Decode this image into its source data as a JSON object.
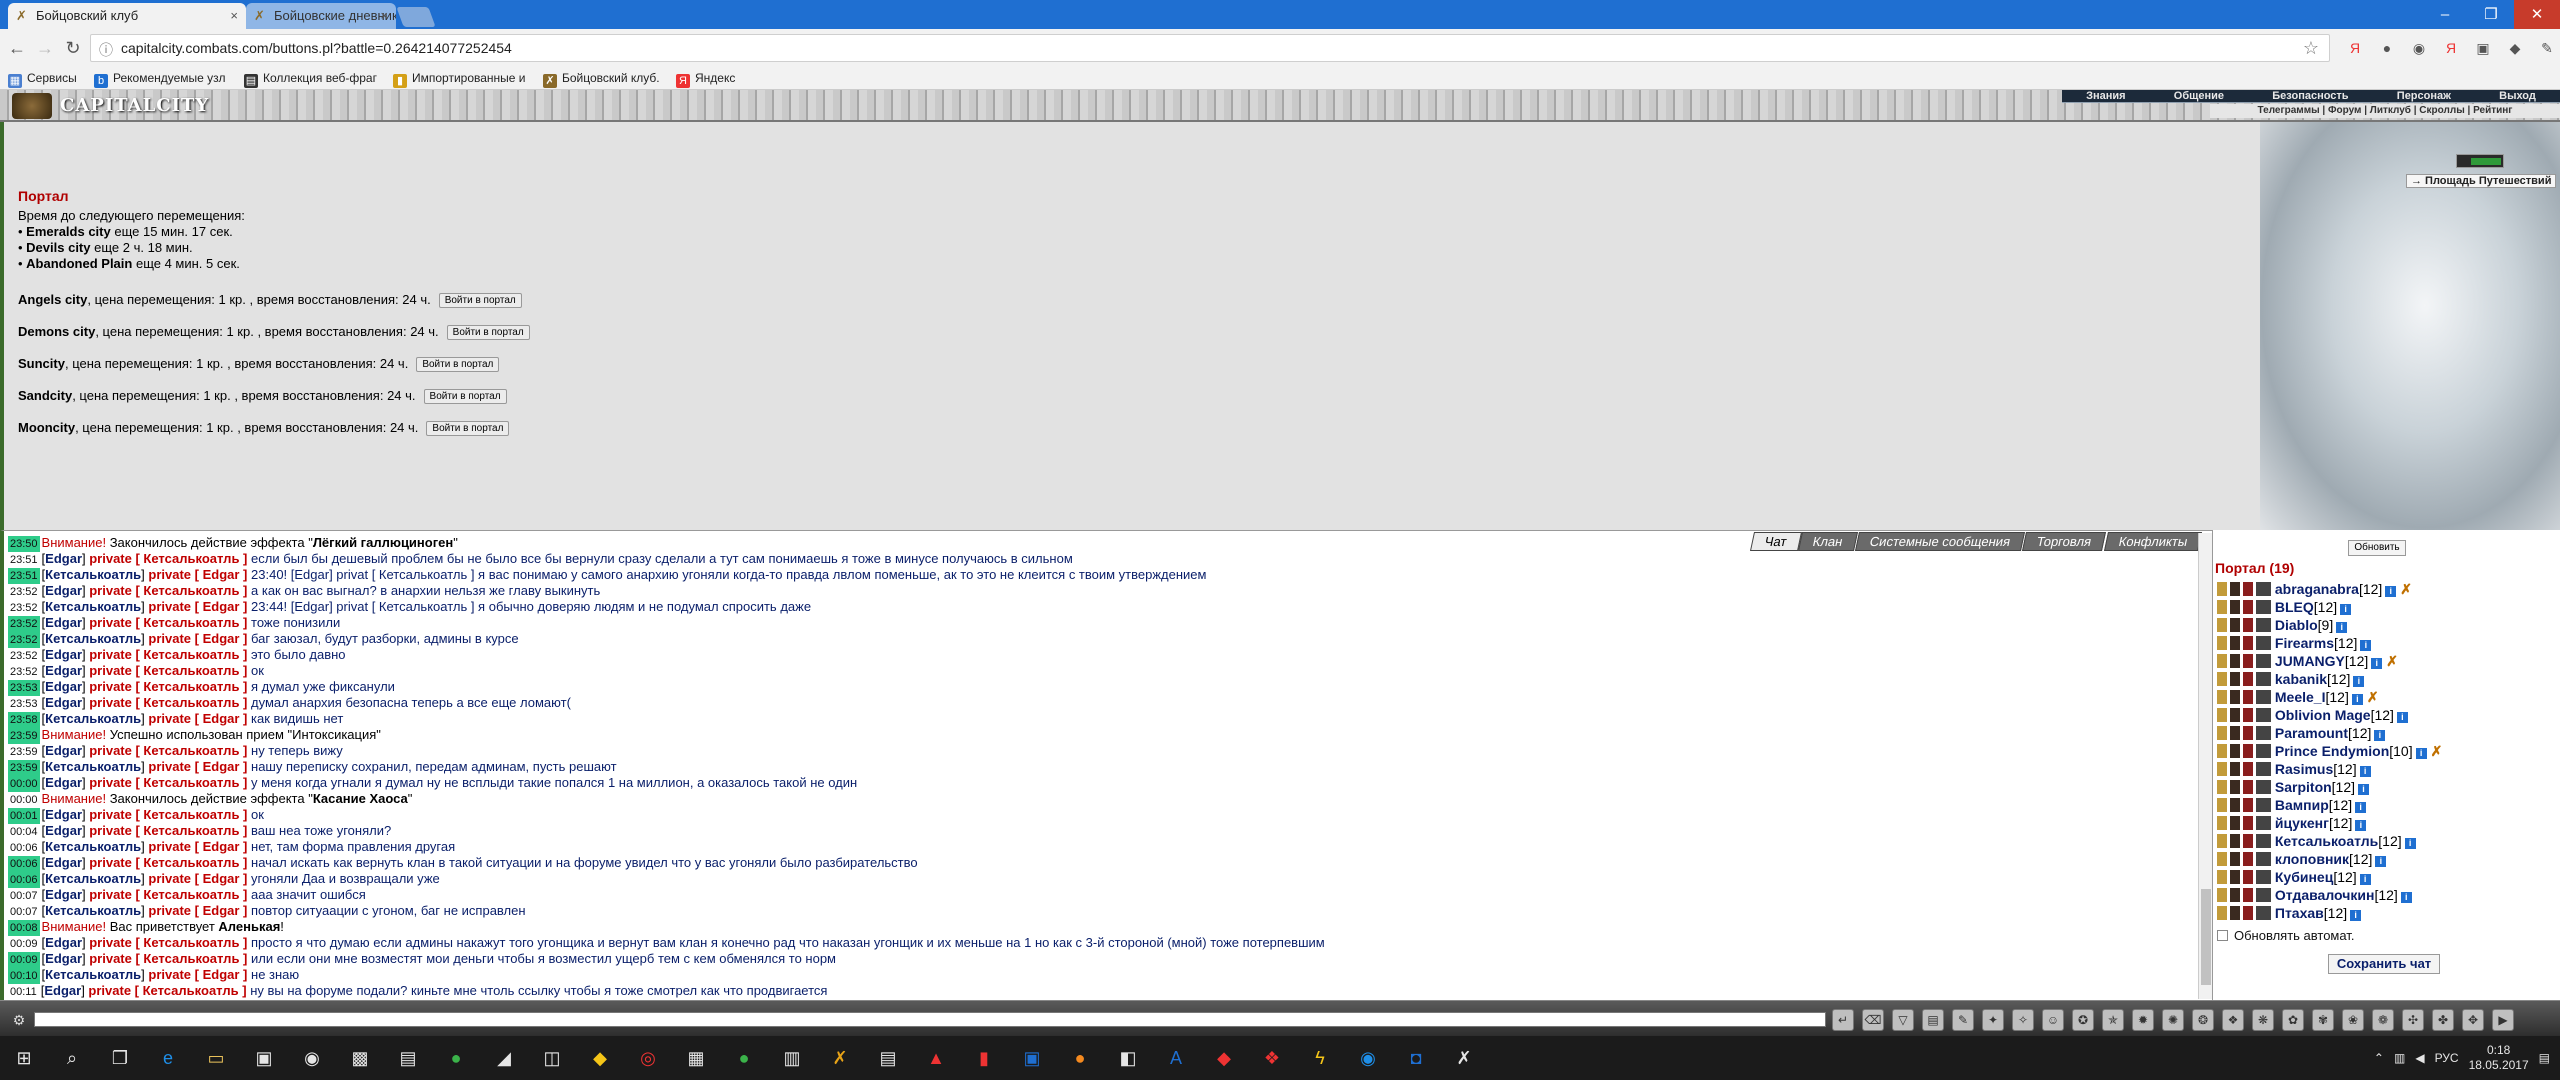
{
  "browser": {
    "tabs": [
      {
        "label": "Бойцовский клуб",
        "close": "×"
      },
      {
        "label": "Бойцовские дневники -",
        "close": "×"
      }
    ],
    "url": "capitalcity.combats.com/buttons.pl?battle=0.264214077252454",
    "bookmarks": [
      "Сервисы",
      "Рекомендуемые узл",
      "Коллекция веб-фраг",
      "Импортированные и",
      "Бойцовский клуб.",
      "Яндекс"
    ]
  },
  "game": {
    "logo": "CAPITALCITY",
    "menu": [
      "Знания",
      "Общение",
      "Безопасность",
      "Персонаж",
      "Выход"
    ],
    "submenu": "Телеграммы | Форум | Литклуб | Скроллы | Рейтинг",
    "location_button": "→ Площадь Путешествий"
  },
  "portal": {
    "title": "Портал",
    "next_move_label": "Время до следующего перемещения:",
    "timers": [
      {
        "city": "Emeralds city",
        "rest": "еще 15 мин. 17 сек."
      },
      {
        "city": "Devils city",
        "rest": "еще 2 ч. 18 мин."
      },
      {
        "city": "Abandoned Plain",
        "rest": "еще 4 мин. 5 сек."
      }
    ],
    "cities": [
      {
        "name": "Angels city",
        "info": ", цена перемещения: 1 кр. , время восстановления: 24 ч."
      },
      {
        "name": "Demons city",
        "info": ", цена перемещения: 1 кр. , время восстановления: 24 ч."
      },
      {
        "name": "Suncity",
        "info": ", цена перемещения: 1 кр. , время восстановления: 24 ч."
      },
      {
        "name": "Sandcity",
        "info": ", цена перемещения: 1 кр. , время восстановления: 24 ч."
      },
      {
        "name": "Mooncity",
        "info": ", цена перемещения: 1 кр. , время восстановления: 24 ч."
      }
    ],
    "enter_button": "Войти в портал"
  },
  "chat": {
    "tabs": [
      "Чат",
      "Клан",
      "Системные сообщения",
      "Торговля",
      "Конфликты"
    ],
    "messages": [
      {
        "t": "23:50",
        "kind": "sys",
        "pre": "Внимание!",
        "text": " Закончилось действие эффекта \"",
        "bold": "Лёгкий галлюциноген",
        "post": "\""
      },
      {
        "t": "23:51",
        "kind": "pm",
        "from": "Edgar",
        "to": "Кетсалькоатль",
        "text": "если был бы дешевый проблем бы не было все бы вернули сразу сделали а тут сам понимаешь я тоже в минусе получаюсь в сильном"
      },
      {
        "t": "23:51",
        "kind": "pm",
        "from": "Кетсалькоатль",
        "to": "Edgar",
        "text": "23:40! [Edgar] privat [ Кетсалькоатль ] я вас понимаю у самого анархию угоняли когда-то правда лвлом поменьше, ак то это не клеится с твоим утверждением"
      },
      {
        "t": "23:52",
        "kind": "pm",
        "from": "Edgar",
        "to": "Кетсалькоатль",
        "text": "а как он вас выгнал? в анархии нельзя же главу выкинуть"
      },
      {
        "t": "23:52",
        "kind": "pm",
        "from": "Кетсалькоатль",
        "to": "Edgar",
        "text": "23:44! [Edgar] privat [ Кетсалькоатль ] я обычно доверяю людям и не подумал спросить даже"
      },
      {
        "t": "23:52",
        "kind": "pm",
        "from": "Edgar",
        "to": "Кетсалькоатль",
        "text": "тоже понизили"
      },
      {
        "t": "23:52",
        "kind": "pm",
        "from": "Кетсалькоатль",
        "to": "Edgar",
        "text": "баг заюзал, будут разборки, админы в курсе"
      },
      {
        "t": "23:52",
        "kind": "pm",
        "from": "Edgar",
        "to": "Кетсалькоатль",
        "text": "это было давно"
      },
      {
        "t": "23:52",
        "kind": "pm",
        "from": "Edgar",
        "to": "Кетсалькоатль",
        "text": "ок"
      },
      {
        "t": "23:53",
        "kind": "pm",
        "from": "Edgar",
        "to": "Кетсалькоатль",
        "text": "я думал уже фиксанули"
      },
      {
        "t": "23:53",
        "kind": "pm",
        "from": "Edgar",
        "to": "Кетсалькоатль",
        "text": "думал анархия безопасна теперь а все еще ломают("
      },
      {
        "t": "23:58",
        "kind": "pm",
        "from": "Кетсалькоатль",
        "to": "Edgar",
        "text": "как видишь нет"
      },
      {
        "t": "23:59",
        "kind": "sys",
        "pre": "Внимание!",
        "text": " Успешно использован прием \"Интоксикация\"",
        "bold": "",
        "post": ""
      },
      {
        "t": "23:59",
        "kind": "pm",
        "from": "Edgar",
        "to": "Кетсалькоатль",
        "text": "ну теперь вижу"
      },
      {
        "t": "23:59",
        "kind": "pm",
        "from": "Кетсалькоатль",
        "to": "Edgar",
        "text": "нашу переписку сохранил, передам админам, пусть решают"
      },
      {
        "t": "00:00",
        "kind": "pm",
        "from": "Edgar",
        "to": "Кетсалькоатль",
        "text": "у меня когда угнали я думал ну не всплыди такие попался 1 на миллион, а оказалось такой не один"
      },
      {
        "t": "00:00",
        "kind": "sys",
        "pre": "Внимание!",
        "text": " Закончилось действие эффекта \"",
        "bold": "Касание Хаоса",
        "post": "\""
      },
      {
        "t": "00:01",
        "kind": "pm",
        "from": "Edgar",
        "to": "Кетсалькоатль",
        "text": "ок"
      },
      {
        "t": "00:04",
        "kind": "pm",
        "from": "Edgar",
        "to": "Кетсалькоатль",
        "text": "ваш неа тоже угоняли?"
      },
      {
        "t": "00:06",
        "kind": "pm",
        "from": "Кетсалькоатль",
        "to": "Edgar",
        "text": "нет, там форма правления другая"
      },
      {
        "t": "00:06",
        "kind": "pm",
        "from": "Edgar",
        "to": "Кетсалькоатль",
        "text": "начал искать как вернуть клан в такой ситуации и на форуме увидел что у вас угоняли было разбирательство"
      },
      {
        "t": "00:06",
        "kind": "pm",
        "from": "Кетсалькоатль",
        "to": "Edgar",
        "text": "угоняли Даа и возвращали уже"
      },
      {
        "t": "00:07",
        "kind": "pm",
        "from": "Edgar",
        "to": "Кетсалькоатль",
        "text": "ааа значит ошибся"
      },
      {
        "t": "00:07",
        "kind": "pm",
        "from": "Кетсалькоатль",
        "to": "Edgar",
        "text": "повтор ситуаации с угоном, баг не исправлен"
      },
      {
        "t": "00:08",
        "kind": "sys",
        "pre": "Внимание!",
        "text": " Вас приветствует ",
        "bold": "Аленькая",
        "post": "!"
      },
      {
        "t": "00:09",
        "kind": "pm",
        "from": "Edgar",
        "to": "Кетсалькоатль",
        "text": "просто я что думаю если админы накажут того угонщика и вернут вам клан я конечно рад что наказан угонщик и их меньше на 1 но как с 3-й стороной (мной) тоже потерпевшим"
      },
      {
        "t": "00:09",
        "kind": "pm",
        "from": "Edgar",
        "to": "Кетсалькоатль",
        "text": "или если они мне возместят мои деньги чтобы я возместил ущерб тем с кем обменялся то норм"
      },
      {
        "t": "00:10",
        "kind": "pm",
        "from": "Кетсалькоатль",
        "to": "Edgar",
        "text": "не знаю"
      },
      {
        "t": "00:11",
        "kind": "pm",
        "from": "Edgar",
        "to": "Кетсалькоатль",
        "text": "ну вы на форуме подали? киньте мне чтоль ссылку чтобы я тоже смотрел как что продвигается"
      }
    ]
  },
  "online": {
    "refresh": "Обновить",
    "title": "Портал (19)",
    "users": [
      {
        "name": "abraganabra",
        "lvl": "[12]",
        "sword": true
      },
      {
        "name": "BLEQ",
        "lvl": "[12]",
        "sword": false
      },
      {
        "name": "Diablo",
        "lvl": "[9]",
        "sword": false
      },
      {
        "name": "Firearms",
        "lvl": "[12]",
        "sword": false
      },
      {
        "name": "JUMANGY",
        "lvl": "[12]",
        "sword": true
      },
      {
        "name": "kabanik",
        "lvl": "[12]",
        "sword": false
      },
      {
        "name": "Meele_I",
        "lvl": "[12]",
        "sword": true
      },
      {
        "name": "Oblivion Mage",
        "lvl": "[12]",
        "sword": false
      },
      {
        "name": "Paramount",
        "lvl": "[12]",
        "sword": false
      },
      {
        "name": "Prince Endymion",
        "lvl": "[10]",
        "sword": true
      },
      {
        "name": "Rasimus",
        "lvl": "[12]",
        "sword": false
      },
      {
        "name": "Sarpiton",
        "lvl": "[12]",
        "sword": false
      },
      {
        "name": "Вампир",
        "lvl": "[12]",
        "sword": false
      },
      {
        "name": "йцукенг",
        "lvl": "[12]",
        "sword": false
      },
      {
        "name": "Кетсалькоатль",
        "lvl": "[12]",
        "sword": false
      },
      {
        "name": "клоповник",
        "lvl": "[12]",
        "sword": false
      },
      {
        "name": "Кубинец",
        "lvl": "[12]",
        "sword": false
      },
      {
        "name": "Отдавалочкин",
        "lvl": "[12]",
        "sword": false
      },
      {
        "name": "Птахав",
        "lvl": "[12]",
        "sword": false
      }
    ],
    "auto_update": "Обновлять автомат.",
    "save_chat": "Сохранить чат"
  },
  "taskbar": {
    "lang": "РУС",
    "time": "0:18",
    "date": "18.05.2017"
  }
}
